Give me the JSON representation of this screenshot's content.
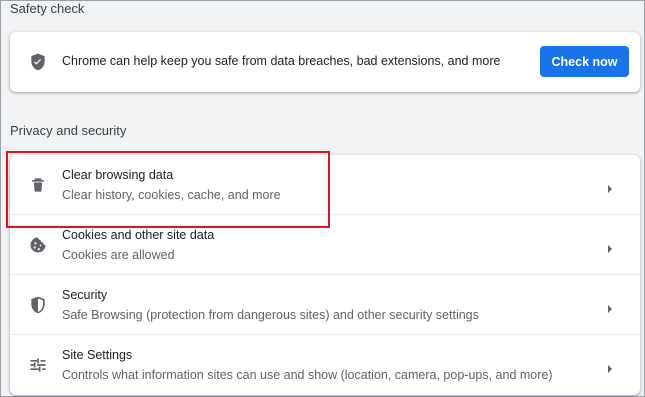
{
  "safety_check": {
    "title": "Safety check",
    "description": "Chrome can help keep you safe from data breaches, bad extensions, and more",
    "button_label": "Check now"
  },
  "privacy": {
    "title": "Privacy and security",
    "items": [
      {
        "label": "Clear browsing data",
        "sublabel": "Clear history, cookies, cache, and more",
        "icon": "trash-icon"
      },
      {
        "label": "Cookies and other site data",
        "sublabel": "Cookies are allowed",
        "icon": "cookie-icon"
      },
      {
        "label": "Security",
        "sublabel": "Safe Browsing (protection from dangerous sites) and other security settings",
        "icon": "shield-icon"
      },
      {
        "label": "Site Settings",
        "sublabel": "Controls what information sites can use and show (location, camera, pop-ups, and more)",
        "icon": "sliders-icon"
      }
    ]
  },
  "colors": {
    "accent": "#1a73e8",
    "highlight_border": "#e0131c",
    "background": "#f1f3f4"
  }
}
